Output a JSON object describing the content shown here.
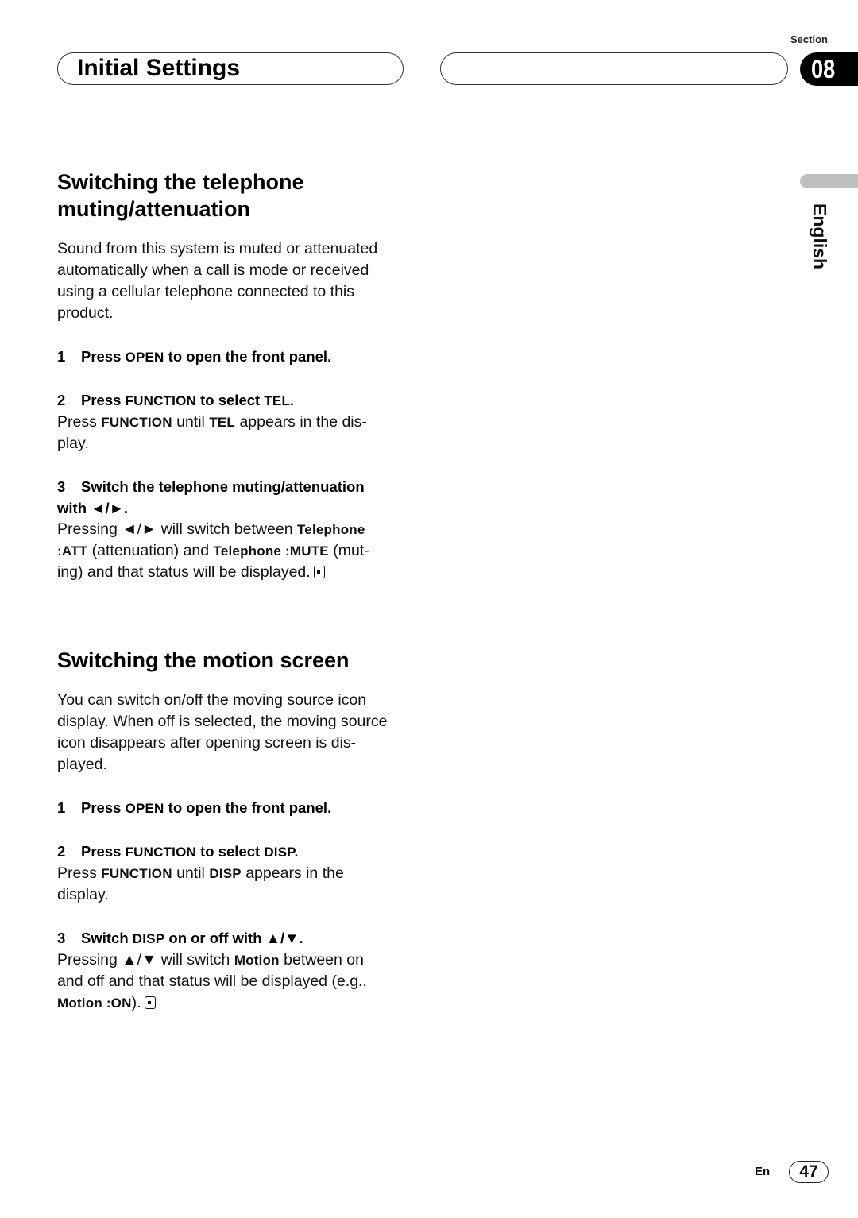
{
  "header": {
    "title": "Initial Settings",
    "section_label": "Section",
    "section_number": "08",
    "language": "English"
  },
  "section1": {
    "heading_line1": "Switching the telephone",
    "heading_line2": "muting/attenuation",
    "intro": [
      "Sound from this system is muted or attenuated",
      "automatically when a call is mode or received",
      "using a cellular telephone connected to this",
      "product."
    ],
    "step1": {
      "num": "1",
      "pre": "Press ",
      "kw": "OPEN",
      "post": " to open the front panel."
    },
    "step2": {
      "num": "2",
      "pre": "Press ",
      "kw": "FUNCTION",
      "mid": " to select ",
      "kw2": "TEL."
    },
    "step2_body": {
      "pre": "Press ",
      "kw": "FUNCTION",
      "mid": " until ",
      "kw2": "TEL",
      "post": " appears in the dis-",
      "line2": "play."
    },
    "step3": {
      "num": "3",
      "line1": "Switch the telephone muting/attenuation",
      "line2": "with ◄/►."
    },
    "step3_body": {
      "l1_pre": "Pressing ◄/► will switch between ",
      "l1_kw": "Telephone",
      "l2_kw": ":ATT",
      "l2_mid": " (attenuation) and ",
      "l2_kw2": "Telephone :MUTE",
      "l2_post": " (mut-",
      "l3": "ing) and that status will be displayed."
    }
  },
  "section2": {
    "heading": "Switching the motion screen",
    "intro": [
      "You can switch on/off the moving source icon",
      "display. When off is selected, the moving source",
      "icon disappears after opening screen is dis-",
      "played."
    ],
    "step1": {
      "num": "1",
      "pre": "Press ",
      "kw": "OPEN",
      "post": " to open the front panel."
    },
    "step2": {
      "num": "2",
      "pre": "Press ",
      "kw": "FUNCTION",
      "mid": " to select ",
      "kw2": "DISP."
    },
    "step2_body": {
      "pre": "Press ",
      "kw": "FUNCTION",
      "mid": " until ",
      "kw2": "DISP",
      "post": " appears in the",
      "line2": "display."
    },
    "step3": {
      "num": "3",
      "pre": "Switch ",
      "kw": "DISP",
      "post": " on or off with ▲/▼."
    },
    "step3_body": {
      "l1_pre": "Pressing ▲/▼ will switch ",
      "l1_kw": "Motion",
      "l1_post": " between on",
      "l2": "and off and that status will be displayed (e.g.,",
      "l3_kw": "Motion :ON",
      "l3_post": ")."
    }
  },
  "footer": {
    "lang_code": "En",
    "page": "47"
  }
}
